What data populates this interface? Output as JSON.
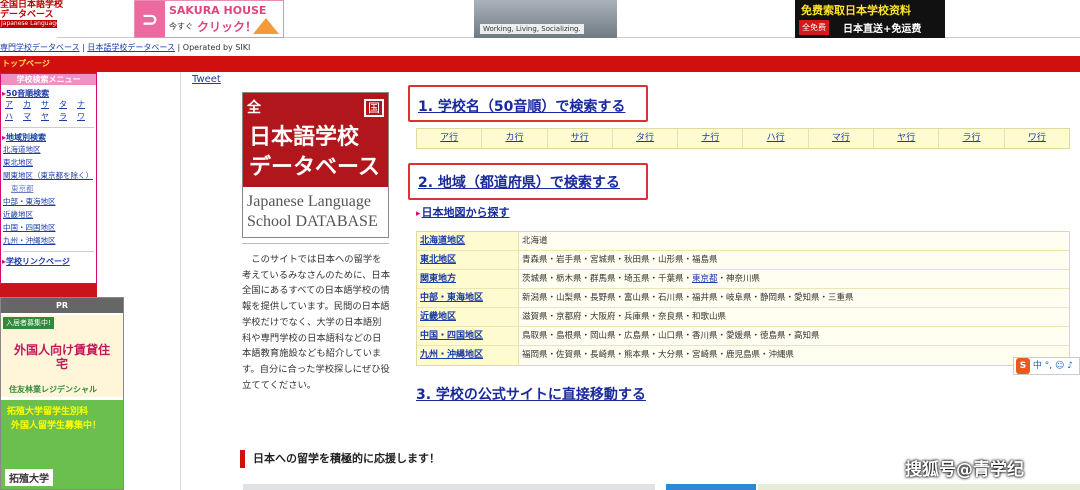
{
  "header": {
    "logo_line1": "全国日本語学校",
    "logo_line2": "データベース",
    "logo_line3": "Japanese Language School Database",
    "sakura_house": "SAKURA HOUSE",
    "sakura_now": "今すぐ",
    "sakura_click": "クリック！",
    "photo_caption": "Working, Living, Socializing.",
    "free_title": "免费索取日本学校资料",
    "free_badge": "全免费",
    "free_sub": "日本直送+免运费"
  },
  "breadcrumb": {
    "link1": "専門学校データベース",
    "sep": " | ",
    "link2": "日本語学校データベース",
    "operated": " | Operated by SIKI"
  },
  "topnav": {
    "label": "トップページ"
  },
  "sidebar": {
    "menu_title": "学校検索メニュー",
    "kana_section": "50音順検索",
    "kana": [
      "ア",
      "カ",
      "サ",
      "タ",
      "ナ",
      "ハ",
      "マ",
      "ヤ",
      "ラ",
      "ワ"
    ],
    "region_section": "地域別検索",
    "regions": [
      "北海道地区",
      "東北地区",
      "関東地区（東京都を除く）",
      "東京都",
      "中部・東海地区",
      "近畿地区",
      "中国・四国地区",
      "九州・沖縄地区"
    ],
    "links_section": "学校リンクページ"
  },
  "pr": {
    "head": "PR",
    "ad1_tag": "入居者募集中!",
    "ad1_title": "外国人向け賃貸住宅",
    "ad1_company": "住友林業レジデンシャル",
    "ad2_line1": "拓殖大学留学生別科",
    "ad2_line2": "外国人留学生募集中！",
    "ad2_uni": "拓殖大学"
  },
  "main": {
    "tweet": "Tweet",
    "db_logo": {
      "zen": "全",
      "koku": "国",
      "line1": "日本語学校",
      "line2": "データベース",
      "en1": "Japanese Language",
      "en2": "School DATABASE"
    },
    "description": "このサイトでは日本への留学を考えているみなさんのために、日本全国にあるすべての日本語学校の情報を提供しています。民間の日本語学校だけでなく、大学の日本語別科や専門学校の日本語科などの日本語教育施設なども紹介しています。自分に合った学校探しにぜひ役立ててください。",
    "heading1": "1. 学校名（50音順）で検索する",
    "kana_row": [
      "ア行",
      "カ行",
      "サ行",
      "タ行",
      "ナ行",
      "ハ行",
      "マ行",
      "ヤ行",
      "ラ行",
      "ワ行"
    ],
    "heading2": "2. 地域（都道府県）で検索する",
    "map_link": "日本地図から探す",
    "regions": [
      {
        "name": "北海道地区",
        "prefs": "北海道"
      },
      {
        "name": "東北地区",
        "prefs": "青森県・岩手県・宮城県・秋田県・山形県・福島県"
      },
      {
        "name": "関東地方",
        "prefs_before": "茨城県・栃木県・群馬県・埼玉県・千葉県・",
        "prefs_link": "東京都",
        "prefs_after": "・神奈川県"
      },
      {
        "name": "中部・東海地区",
        "prefs": "新潟県・山梨県・長野県・富山県・石川県・福井県・岐阜県・静岡県・愛知県・三重県"
      },
      {
        "name": "近畿地区",
        "prefs": "滋賀県・京都府・大阪府・兵庫県・奈良県・和歌山県"
      },
      {
        "name": "中国・四国地区",
        "prefs": "鳥取県・島根県・岡山県・広島県・山口県・香川県・愛媛県・徳島県・高知県"
      },
      {
        "name": "九州・沖縄地区",
        "prefs": "福岡県・佐賀県・長崎県・熊本県・大分県・宮崎県・鹿児島県・沖縄県"
      }
    ],
    "heading3": "3. 学校の公式サイトに直接移動する",
    "support": "日本への留学を積極的に応援します！"
  },
  "ime": {
    "badge": "S",
    "text": "中 °, ☺ ♪"
  },
  "watermark": "搜狐号@青学纪",
  "colors": {
    "brand_red": "#d10f0f",
    "link_blue": "#1a3ba8",
    "highlight_box": "#d93333",
    "table_bg": "#fffbd0"
  }
}
